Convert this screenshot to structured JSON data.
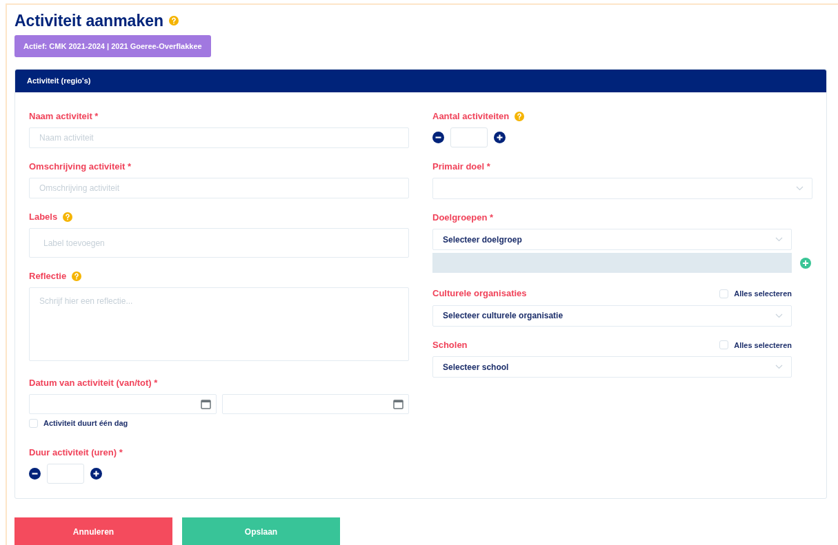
{
  "title": "Activiteit aanmaken",
  "title_help": true,
  "badge": "Actief: CMK 2021-2024 | 2021 Goeree-Overflakkee",
  "panel": {
    "title": "Activiteit (regio's)",
    "left": [
      {
        "kind": "text",
        "label": "Naam activiteit *",
        "placeholder": "Naam activiteit"
      },
      {
        "kind": "text",
        "label": "Omschrijving activiteit *",
        "placeholder": "Omschrijving activiteit"
      },
      {
        "kind": "tags",
        "label": "Labels",
        "help": true,
        "placeholder": "Label toevoegen"
      },
      {
        "kind": "textarea",
        "label": "Reflectie",
        "help": true,
        "placeholder": "Schrijf hier een reflectie..."
      },
      {
        "kind": "daterange",
        "label": "Datum van activiteit (van/tot) *",
        "checkbox": {
          "label": "Activiteit duurt één dag",
          "checked": false
        }
      },
      {
        "kind": "stepper",
        "label": "Duur activiteit (uren) *"
      }
    ],
    "right": [
      {
        "kind": "stepper",
        "label": "Aantal activiteiten",
        "help": true
      },
      {
        "kind": "select",
        "label": "Primair doel *",
        "wide": true
      },
      {
        "kind": "select",
        "label": "Doelgroepen *",
        "placeholder": "Selecteer doelgroep",
        "add_row": true
      },
      {
        "kind": "select",
        "label": "Culturele organisaties",
        "placeholder": "Selecteer culturele organisatie",
        "select_all": {
          "label": "Alles selecteren",
          "checked": false
        }
      },
      {
        "kind": "select",
        "label": "Scholen",
        "placeholder": "Selecteer school",
        "select_all": {
          "label": "Alles selecteren",
          "checked": false
        }
      }
    ]
  },
  "buttons": [
    {
      "label": "Annuleren",
      "kind": "cancel"
    },
    {
      "label": "Opslaan",
      "kind": "save"
    }
  ]
}
